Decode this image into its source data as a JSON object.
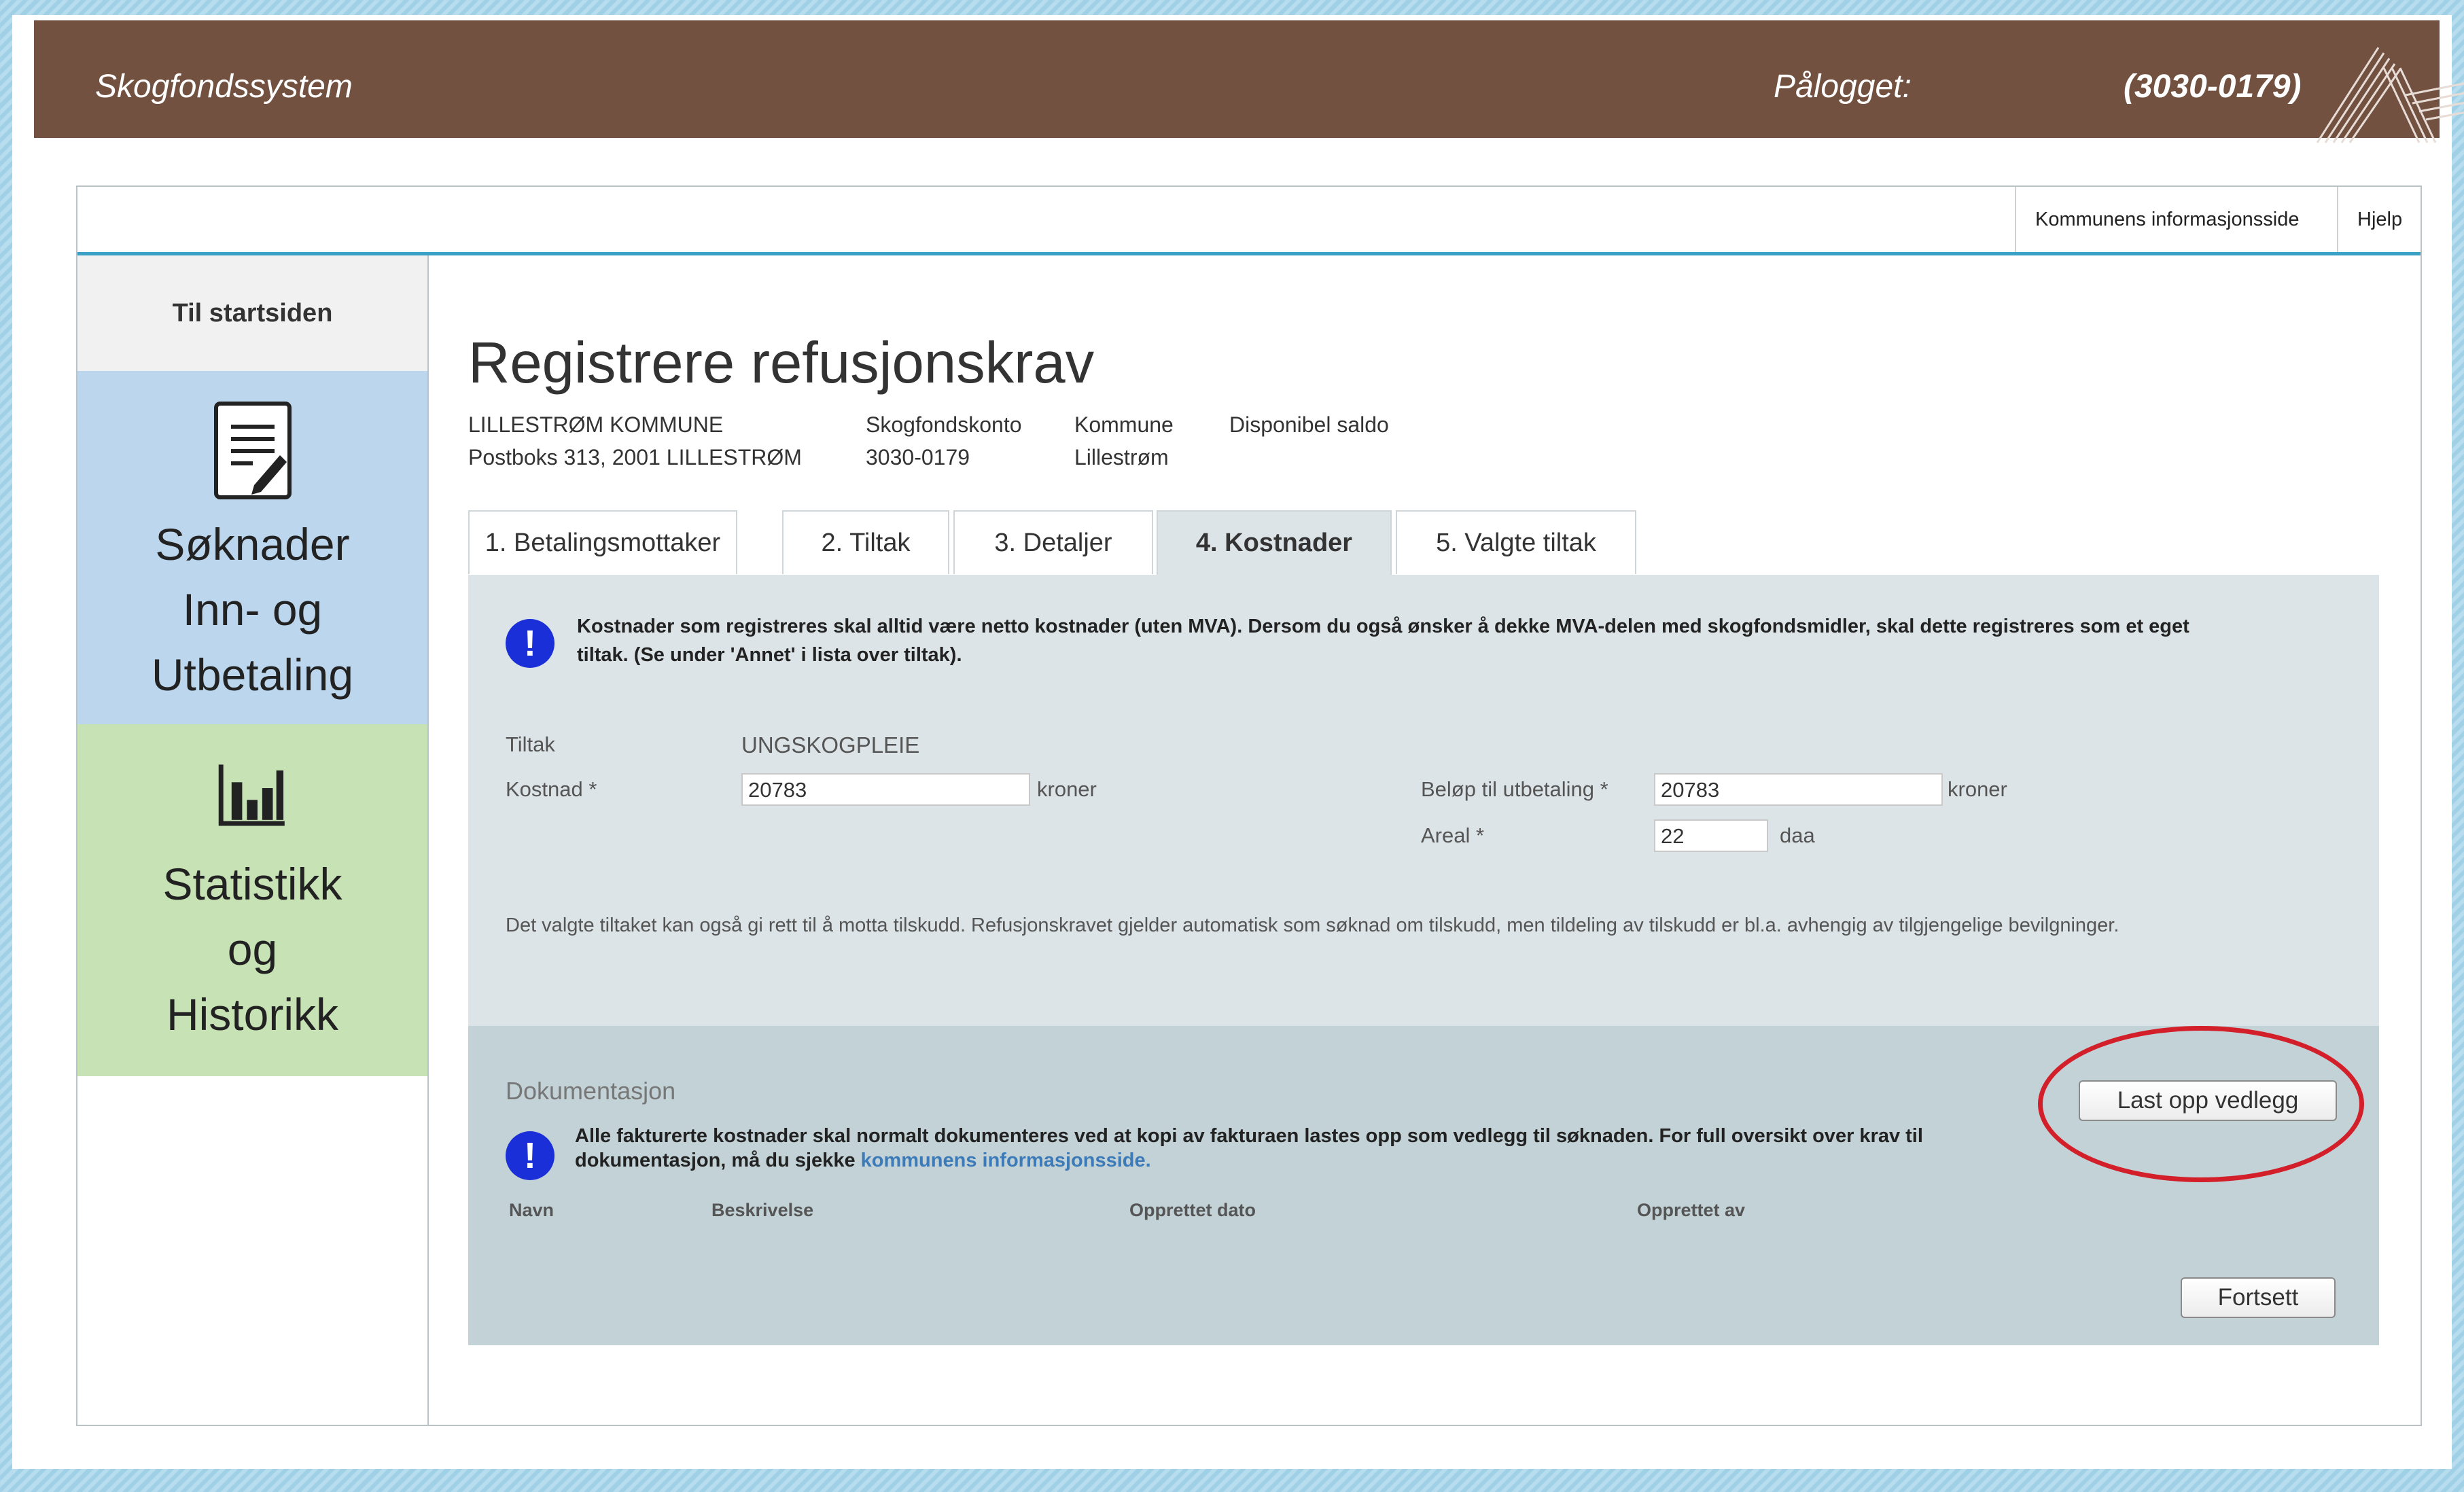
{
  "header": {
    "brand": "Skogfondssystem",
    "logged_in_label": "Pålogget:",
    "account": "(3030-0179)"
  },
  "top_links": [
    "Kommunens informasjonsside",
    "Hjelp"
  ],
  "sidebar": {
    "start": "Til startsiden",
    "applications": [
      "Søknader",
      "Inn- og",
      "Utbetaling"
    ],
    "statistics": [
      "Statistikk",
      "og",
      "Historikk"
    ]
  },
  "page": {
    "title": "Registrere refusjonskrav",
    "org_name": "LILLESTRØM KOMMUNE",
    "org_address": "Postboks 313, 2001 LILLESTRØM",
    "account_label": "Skogfondskonto",
    "account_value": "3030-0179",
    "municipality_label": "Kommune",
    "municipality_value": "Lillestrøm",
    "balance_label": "Disponibel saldo"
  },
  "tabs": [
    "1. Betalingsmottaker",
    "2. Tiltak",
    "3. Detaljer",
    "4. Kostnader",
    "5. Valgte tiltak"
  ],
  "costs": {
    "notice_line1": "Kostnader som registreres skal alltid være netto kostnader (uten MVA). Dersom du også ønsker å dekke MVA-delen med skogfondsmidler, skal dette registreres som et eget",
    "notice_line2": "tiltak. (Se under 'Annet' i lista over tiltak).",
    "measure_label": "Tiltak",
    "measure_value": "UNGSKOGPLEIE",
    "cost_label": "Kostnad *",
    "cost_value": "20783",
    "cost_unit": "kroner",
    "payout_label": "Beløp til utbetaling *",
    "payout_value": "20783",
    "payout_unit": "kroner",
    "area_label": "Areal *",
    "area_value": "22",
    "area_unit": "daa",
    "grant_text": "Det valgte tiltaket kan også gi rett til å motta tilskudd. Refusjonskravet gjelder automatisk som søknad om tilskudd, men tildeling av tilskudd er bl.a. avhengig av tilgjengelige bevilgninger."
  },
  "documentation": {
    "title": "Dokumentasjon",
    "upload_button": "Last opp vedlegg",
    "notice_line1": "Alle fakturerte kostnader skal normalt dokumenteres ved at kopi av fakturaen lastes opp som vedlegg til søknaden. For full oversikt over krav til",
    "notice_line2_prefix": "dokumentasjon, må du sjekke",
    "notice_link": "kommunens informasjonsside.",
    "columns": [
      "Navn",
      "Beskrivelse",
      "Opprettet dato",
      "Opprettet av"
    ],
    "continue_button": "Fortsett"
  }
}
